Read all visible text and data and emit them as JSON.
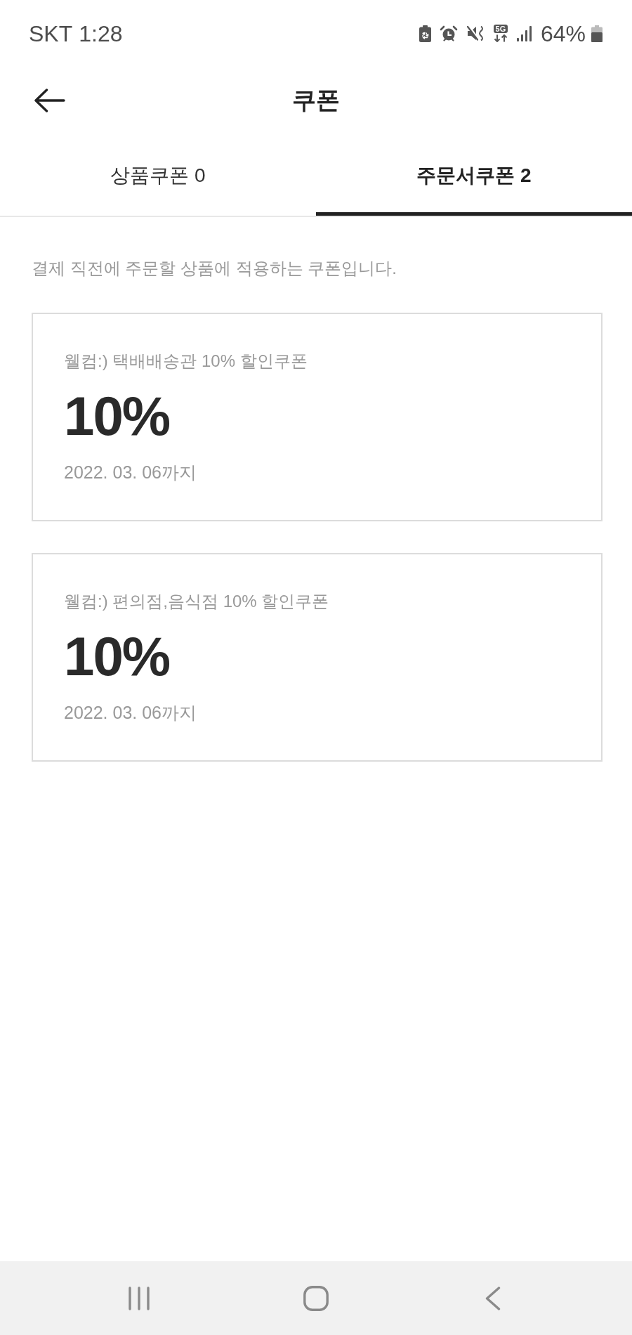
{
  "status_bar": {
    "carrier": "SKT",
    "time": "1:28",
    "network": "5G",
    "battery": "64%"
  },
  "header": {
    "title": "쿠폰"
  },
  "tabs": [
    {
      "label": "상품쿠폰 0",
      "selected": false
    },
    {
      "label": "주문서쿠폰 2",
      "selected": true
    }
  ],
  "description": "결제 직전에 주문할 상품에 적용하는 쿠폰입니다.",
  "coupons": [
    {
      "name": "웰컴:) 택배배송관 10% 할인쿠폰",
      "discount": "10%",
      "expiry": "2022. 03. 06까지"
    },
    {
      "name": "웰컴:) 편의점,음식점 10% 할인쿠폰",
      "discount": "10%",
      "expiry": "2022. 03. 06까지"
    }
  ]
}
